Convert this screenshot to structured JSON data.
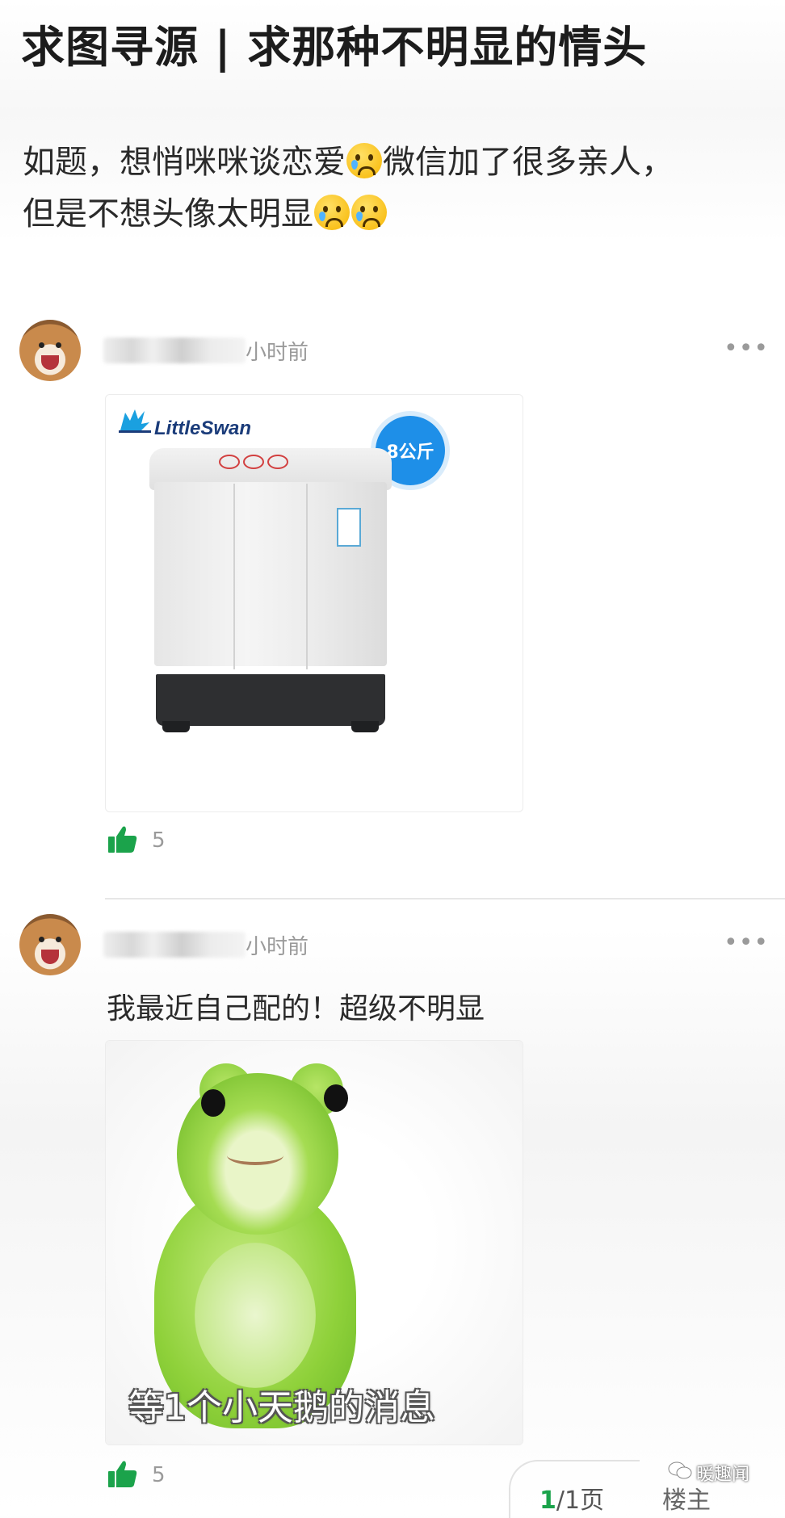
{
  "thread": {
    "title": "求图寻源 | 求那种不明显的情头",
    "body_line1_part1": "如题，想悄咪咪谈恋爱",
    "body_line1_part2": "微信加了很多亲人，",
    "body_line2": "但是不想头像太明显",
    "emoji_name": "crying-face"
  },
  "comments": [
    {
      "time": "小时前",
      "more": "•••",
      "image": {
        "brand": "LittleSwan",
        "badge": "8公斤"
      },
      "likes": "5"
    },
    {
      "time": "小时前",
      "more": "•••",
      "text": "我最近自己配的！超级不明显",
      "image": {
        "caption": "等1个小天鹅的消息"
      },
      "likes": "5"
    }
  ],
  "footer": {
    "page_current": "1",
    "page_rest": "/1页",
    "op_label": "楼主",
    "watermark": "暖趣闻"
  },
  "colors": {
    "like_green": "#1ba34b",
    "badge_blue": "#1e8fe8"
  }
}
